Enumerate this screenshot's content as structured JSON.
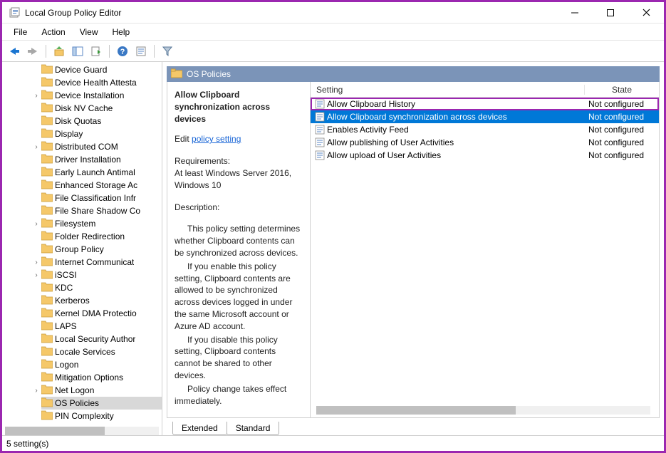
{
  "window": {
    "title": "Local Group Policy Editor"
  },
  "menu": {
    "file": "File",
    "action": "Action",
    "view": "View",
    "help": "Help"
  },
  "tree": {
    "items": [
      {
        "label": "Device Guard",
        "expandable": false
      },
      {
        "label": "Device Health Attesta",
        "expandable": false
      },
      {
        "label": "Device Installation",
        "expandable": true
      },
      {
        "label": "Disk NV Cache",
        "expandable": false
      },
      {
        "label": "Disk Quotas",
        "expandable": false
      },
      {
        "label": "Display",
        "expandable": false
      },
      {
        "label": "Distributed COM",
        "expandable": true
      },
      {
        "label": "Driver Installation",
        "expandable": false
      },
      {
        "label": "Early Launch Antimal",
        "expandable": false
      },
      {
        "label": "Enhanced Storage Ac",
        "expandable": false
      },
      {
        "label": "File Classification Infr",
        "expandable": false
      },
      {
        "label": "File Share Shadow Co",
        "expandable": false
      },
      {
        "label": "Filesystem",
        "expandable": true
      },
      {
        "label": "Folder Redirection",
        "expandable": false
      },
      {
        "label": "Group Policy",
        "expandable": false
      },
      {
        "label": "Internet Communicat",
        "expandable": true
      },
      {
        "label": "iSCSI",
        "expandable": true
      },
      {
        "label": "KDC",
        "expandable": false
      },
      {
        "label": "Kerberos",
        "expandable": false
      },
      {
        "label": "Kernel DMA Protectio",
        "expandable": false
      },
      {
        "label": "LAPS",
        "expandable": false
      },
      {
        "label": "Local Security Author",
        "expandable": false
      },
      {
        "label": "Locale Services",
        "expandable": false
      },
      {
        "label": "Logon",
        "expandable": false
      },
      {
        "label": "Mitigation Options",
        "expandable": false
      },
      {
        "label": "Net Logon",
        "expandable": true
      },
      {
        "label": "OS Policies",
        "expandable": false,
        "selected": true
      },
      {
        "label": "PIN Complexity",
        "expandable": false
      }
    ]
  },
  "pane": {
    "title": "OS Policies",
    "desc_title": "Allow Clipboard synchronization across devices",
    "edit_prefix": "Edit ",
    "edit_link": "policy setting",
    "req_label": "Requirements:",
    "req_text": "At least Windows Server 2016, Windows 10",
    "desc_label": "Description:",
    "desc_p1": "This policy setting determines whether Clipboard contents can be synchronized across devices.",
    "desc_p2": "If you enable this policy setting, Clipboard contents are allowed to be synchronized across devices logged in under the same Microsoft account or Azure AD account.",
    "desc_p3": "If you disable this policy setting, Clipboard contents cannot be shared to other devices.",
    "desc_p4": "Policy change takes effect immediately."
  },
  "columns": {
    "setting": "Setting",
    "state": "State"
  },
  "settings": [
    {
      "name": "Allow Clipboard History",
      "state": "Not configured",
      "highlighted": true
    },
    {
      "name": "Allow Clipboard synchronization across devices",
      "state": "Not configured",
      "selected": true
    },
    {
      "name": "Enables Activity Feed",
      "state": "Not configured"
    },
    {
      "name": "Allow publishing of User Activities",
      "state": "Not configured"
    },
    {
      "name": "Allow upload of User Activities",
      "state": "Not configured"
    }
  ],
  "tabs": {
    "extended": "Extended",
    "standard": "Standard"
  },
  "status": "5 setting(s)"
}
